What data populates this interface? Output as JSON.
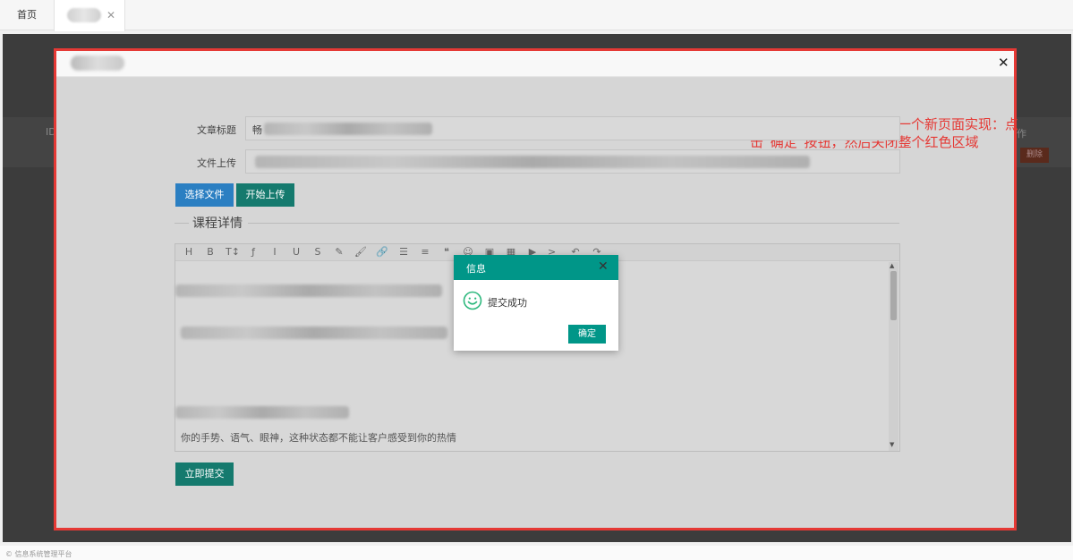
{
  "tabs": {
    "home_label": "首页",
    "close_glyph": "✕"
  },
  "background": {
    "left_label": "ID",
    "right_label": "作",
    "delete_label": "删除",
    "footer_text": "© 信息系统管理平台"
  },
  "dialog": {
    "close_glyph": "✕",
    "note": "整个红色部分是弹出来的一个新页面实现：点击“确定”按钮，然后关闭整个红色区域",
    "fields": {
      "title_label": "文章标题",
      "title_value_prefix": "畅",
      "upload_label": "文件上传"
    },
    "buttons": {
      "choose_file": "选择文件",
      "start_upload": "开始上传",
      "submit": "立即提交"
    },
    "section_title": "课程详情",
    "editor": {
      "toolbar": [
        "H",
        "B",
        "T↕",
        "ƒ",
        "I",
        "U",
        "S",
        "✎",
        "🖌",
        "🔗",
        "☰",
        "≡",
        "❝",
        "☺",
        "▣",
        "▦",
        "▶",
        ">_",
        "↶",
        "↷"
      ],
      "visible_text": "你的手势、语气、眼神，这种状态都不能让客户感受到你的热情"
    }
  },
  "message_box": {
    "title": "信息",
    "close_glyph": "✕",
    "text": "提交成功",
    "ok_label": "确定",
    "accent_color": "#009688",
    "icon": "smile-icon"
  },
  "colors": {
    "highlight_border": "#e53935",
    "primary_button": "#2b7fc2",
    "teal_button": "#157a6e"
  }
}
